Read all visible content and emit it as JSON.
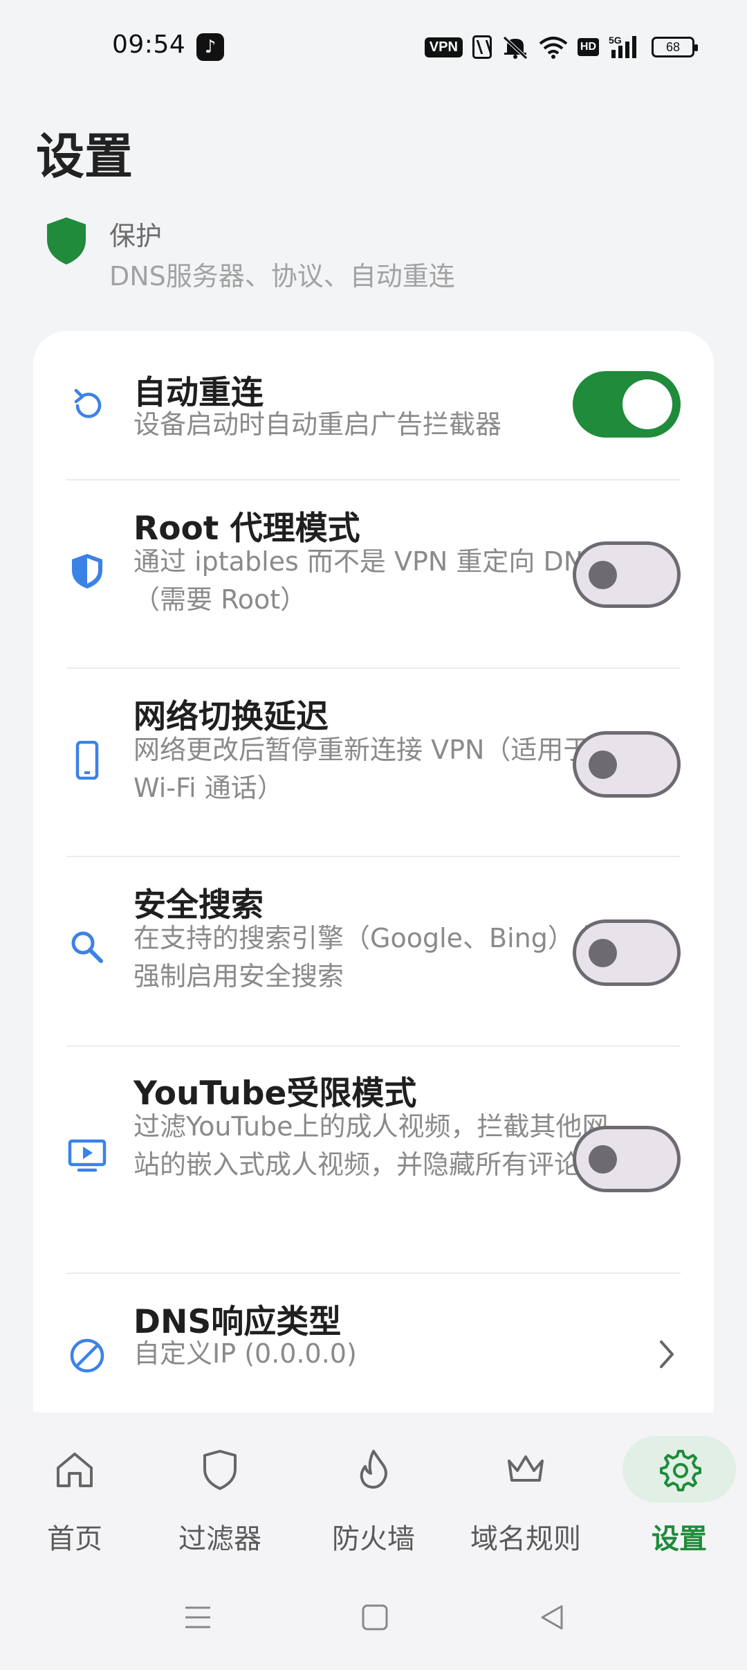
{
  "status_bar": {
    "time": "09:54",
    "vpn": "VPN",
    "hd": "HD",
    "network": "5G",
    "battery": "68"
  },
  "page": {
    "title": "设置"
  },
  "section": {
    "title": "保护",
    "subtitle": "DNS服务器、协议、自动重连"
  },
  "settings": [
    {
      "title": "自动重连",
      "desc": "设备启动时自动重启广告拦截器",
      "enabled": true,
      "icon": "refresh-icon"
    },
    {
      "title": "Root 代理模式",
      "desc": "通过 iptables 而不是 VPN 重定向 DNS（需要 Root）",
      "enabled": false,
      "icon": "shield-icon"
    },
    {
      "title": "网络切换延迟",
      "desc": "网络更改后暂停重新连接 VPN（适用于 Wi-Fi 通话）",
      "enabled": false,
      "icon": "phone-icon"
    },
    {
      "title": "安全搜索",
      "desc": "在支持的搜索引擎（Google、Bing）上强制启用安全搜索",
      "enabled": false,
      "icon": "search-icon"
    },
    {
      "title": "YouTube受限模式",
      "desc": "过滤YouTube上的成人视频，拦截其他网站的嵌入式成人视频，并隐藏所有评论",
      "enabled": false,
      "icon": "video-icon"
    },
    {
      "title": "DNS响应类型",
      "desc": "自定义IP (0.0.0.0)",
      "icon": "block-icon"
    }
  ],
  "bottom_nav": [
    {
      "label": "首页",
      "icon": "home-icon",
      "active": false
    },
    {
      "label": "过滤器",
      "icon": "filter-shield-icon",
      "active": false
    },
    {
      "label": "防火墙",
      "icon": "fire-icon",
      "active": false
    },
    {
      "label": "域名规则",
      "icon": "crown-icon",
      "active": false
    },
    {
      "label": "设置",
      "icon": "gear-icon",
      "active": true
    }
  ],
  "colors": {
    "accent": "#1f8b3b",
    "icon_blue": "#3b82e6",
    "toggle_off_track": "#e8e2ea",
    "toggle_off_border": "#6e6a72"
  }
}
